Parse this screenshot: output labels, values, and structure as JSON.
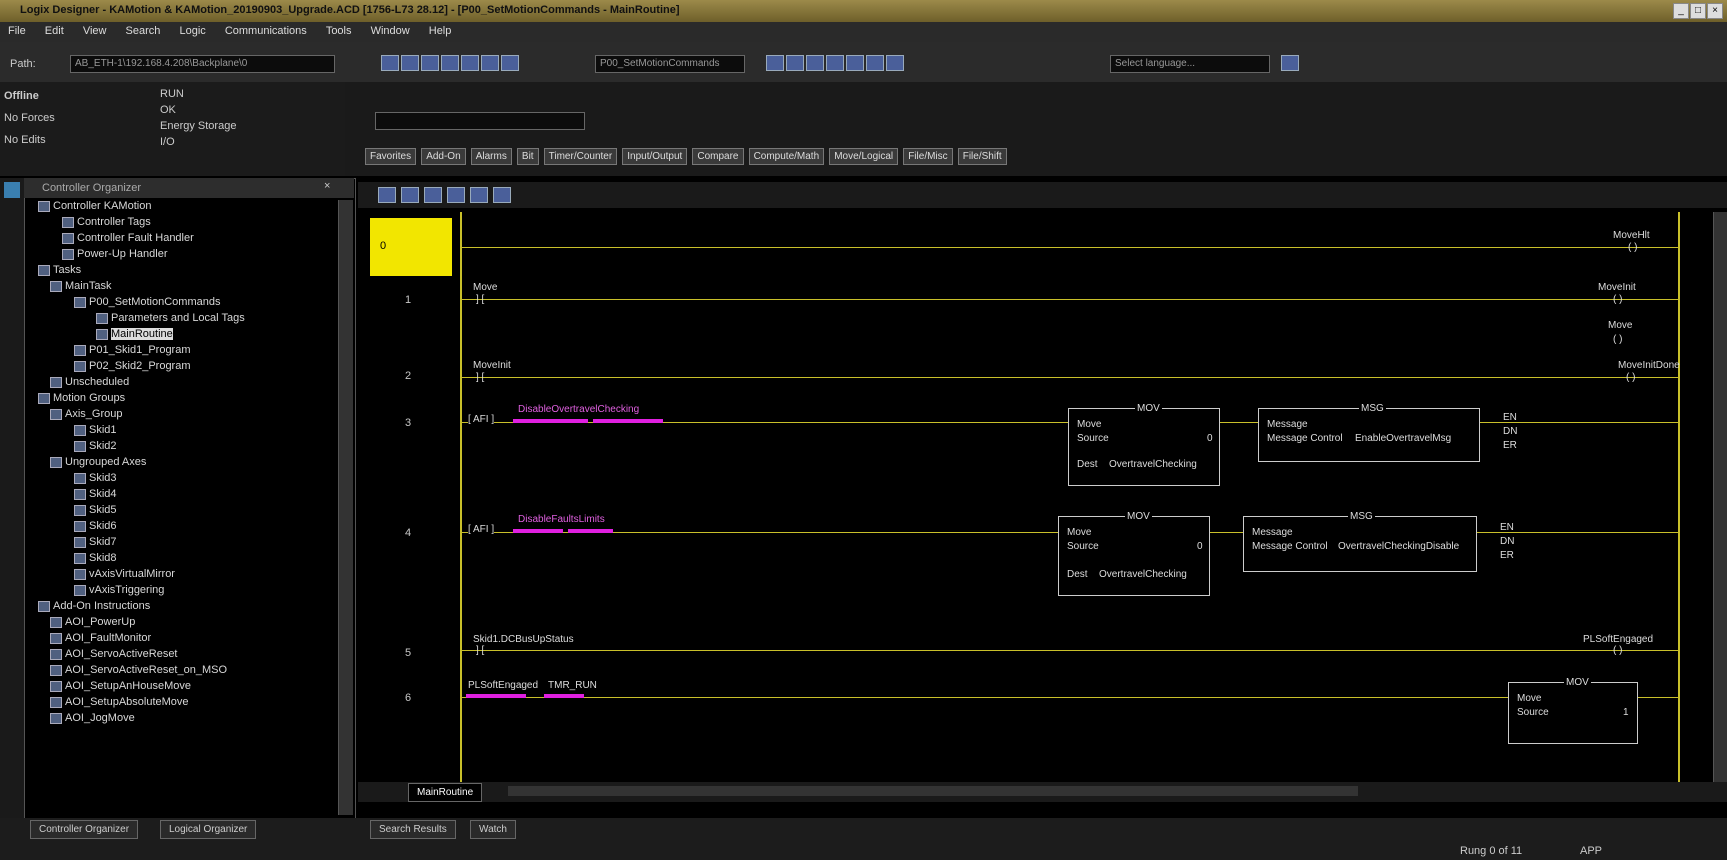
{
  "window": {
    "title": "Logix Designer - KAMotion & KAMotion_20190903_Upgrade.ACD [1756-L73 28.12] - [P00_SetMotionCommands - MainRoutine]"
  },
  "menu": [
    "File",
    "Edit",
    "View",
    "Search",
    "Logic",
    "Communications",
    "Tools",
    "Window",
    "Help"
  ],
  "toolbar": {
    "path_label": "Path:",
    "path_value": "AB_ETH-1\\192.168.4.208\\Backplane\\0",
    "routine_select": "P00_SetMotionCommands",
    "search_placeholder": "Select language..."
  },
  "status_panel": {
    "mode": "Offline",
    "forces": "No Forces",
    "edits": "No Edits",
    "flags": [
      "RUN",
      "OK",
      "Energy Storage",
      "I/O"
    ]
  },
  "instruction_tabs": [
    "Favorites",
    "Add-On",
    "Alarms",
    "Bit",
    "Timer/Counter",
    "Input/Output",
    "Compare",
    "Compute/Math",
    "Move/Logical",
    "File/Misc",
    "File/Shift"
  ],
  "organizer": {
    "title": "Controller Organizer",
    "items": [
      "Controller KAMotion",
      "Controller Tags",
      "Controller Fault Handler",
      "Power-Up Handler",
      "Tasks",
      "MainTask",
      "P00_SetMotionCommands",
      "Parameters and Local Tags",
      "MainRoutine",
      "P01_Skid1_Program",
      "P02_Skid2_Program",
      "Unscheduled",
      "Motion Groups",
      "Axis_Group",
      "Skid1",
      "Skid2",
      "Ungrouped Axes",
      "Skid3",
      "Skid4",
      "Skid5",
      "Skid6",
      "Skid7",
      "Skid8",
      "vAxisVirtualMirror",
      "vAxisTriggering",
      "Add-On Instructions",
      "AOI_PowerUp",
      "AOI_FaultMonitor",
      "AOI_ServoActiveReset",
      "AOI_ServoActiveReset_on_MSO",
      "AOI_SetupAnHouseMove",
      "AOI_SetupAbsoluteMove",
      "AOI_JogMove"
    ]
  },
  "ladder": {
    "rungs": [
      {
        "num": "0",
        "coil": "MoveHlt"
      },
      {
        "num": "1",
        "contact": "Move",
        "coil": "MoveInit",
        "coil2": "Move"
      },
      {
        "num": "2",
        "contact": "MoveInit",
        "coil": "MoveInitDone"
      },
      {
        "num": "3",
        "afi": "AFI",
        "magenta_tag": "DisableOvertravelChecking",
        "mov_title": "MOV",
        "mov_move": "Move",
        "mov_source_label": "Source",
        "mov_source_val": "0",
        "mov_dest_label": "Dest",
        "mov_dest_val": "OvertravelChecking",
        "msg_title": "MSG",
        "msg_label": "Message",
        "msg_control_label": "Message Control",
        "msg_control_val": "EnableOvertravelMsg",
        "outs": [
          "EN",
          "DN",
          "ER"
        ]
      },
      {
        "num": "4",
        "afi": "AFI",
        "magenta_tag": "DisableFaultsLimits",
        "mov_title": "MOV",
        "mov_move": "Move",
        "mov_source_label": "Source",
        "mov_source_val": "0",
        "mov_dest_label": "Dest",
        "mov_dest_val": "OvertravelChecking",
        "msg_title": "MSG",
        "msg_label": "Message",
        "msg_control_label": "Message Control",
        "msg_control_val": "OvertravelCheckingDisable",
        "outs": [
          "EN",
          "DN",
          "ER"
        ]
      },
      {
        "num": "5",
        "contact": "Skid1.DCBusUpStatus",
        "coil": "PLSoftEngaged"
      },
      {
        "num": "6",
        "contact": "PLSoftEngaged",
        "contact2": "TMR_RUN",
        "mov_title": "MOV",
        "mov_move": "Move",
        "mov_source_label": "Source",
        "mov_source_val": "1"
      }
    ]
  },
  "bottom": {
    "routine_tab": "MainRoutine",
    "organizer_tab": "Controller Organizer",
    "logical_tab": "Logical Organizer",
    "search_tab": "Search Results",
    "watch_tab": "Watch",
    "status": "Rung 0 of 11",
    "app": "APP"
  }
}
